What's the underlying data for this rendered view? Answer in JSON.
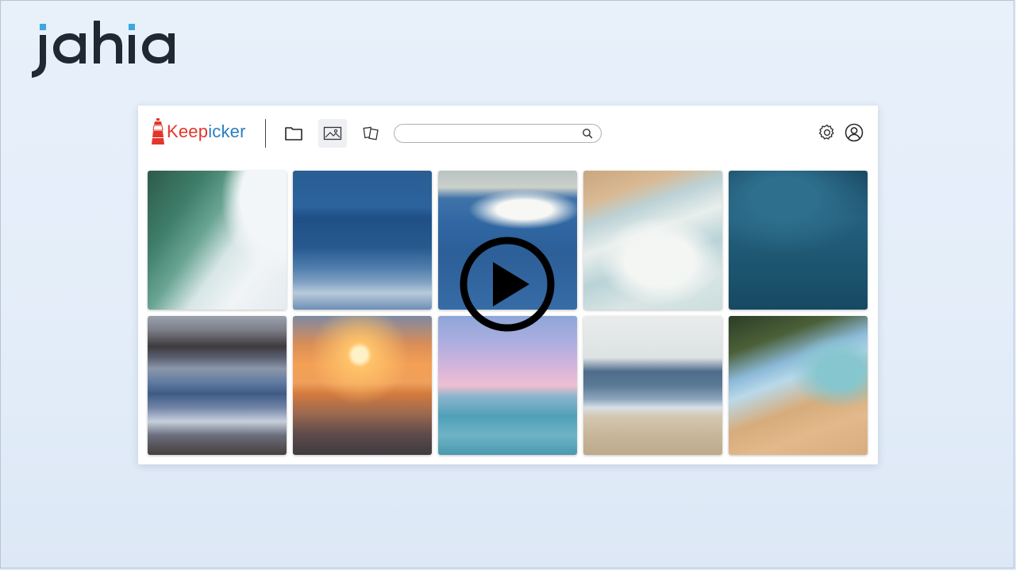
{
  "brand": {
    "name": "jahia"
  },
  "app": {
    "logo_prefix": "Keep",
    "logo_suffix": "icker",
    "logo_mark": "lighthouse-icon",
    "toolbar": {
      "folder_icon": "folder-icon",
      "images_icon": "image-icon",
      "documents_icon": "documents-icon"
    },
    "search": {
      "placeholder": "",
      "value": ""
    },
    "settings_icon": "gear-icon",
    "account_icon": "user-circle-icon"
  },
  "gallery": {
    "rows": [
      [
        {
          "subject": "wave-curl"
        },
        {
          "subject": "ocean-wave"
        },
        {
          "subject": "breaking-wave"
        },
        {
          "subject": "shore-foam"
        },
        {
          "subject": "underwater"
        }
      ],
      [
        {
          "subject": "coastline-waves"
        },
        {
          "subject": "sunset-sea"
        },
        {
          "subject": "pastel-sea"
        },
        {
          "subject": "beach-waves"
        },
        {
          "subject": "palm-beach"
        }
      ]
    ]
  },
  "overlay": {
    "icon": "play-icon"
  },
  "colors": {
    "keep_red": "#e2362b",
    "icker_blue": "#2b7fc0",
    "jahia_dark": "#1f2933",
    "jahia_accent": "#3aa7e0"
  }
}
